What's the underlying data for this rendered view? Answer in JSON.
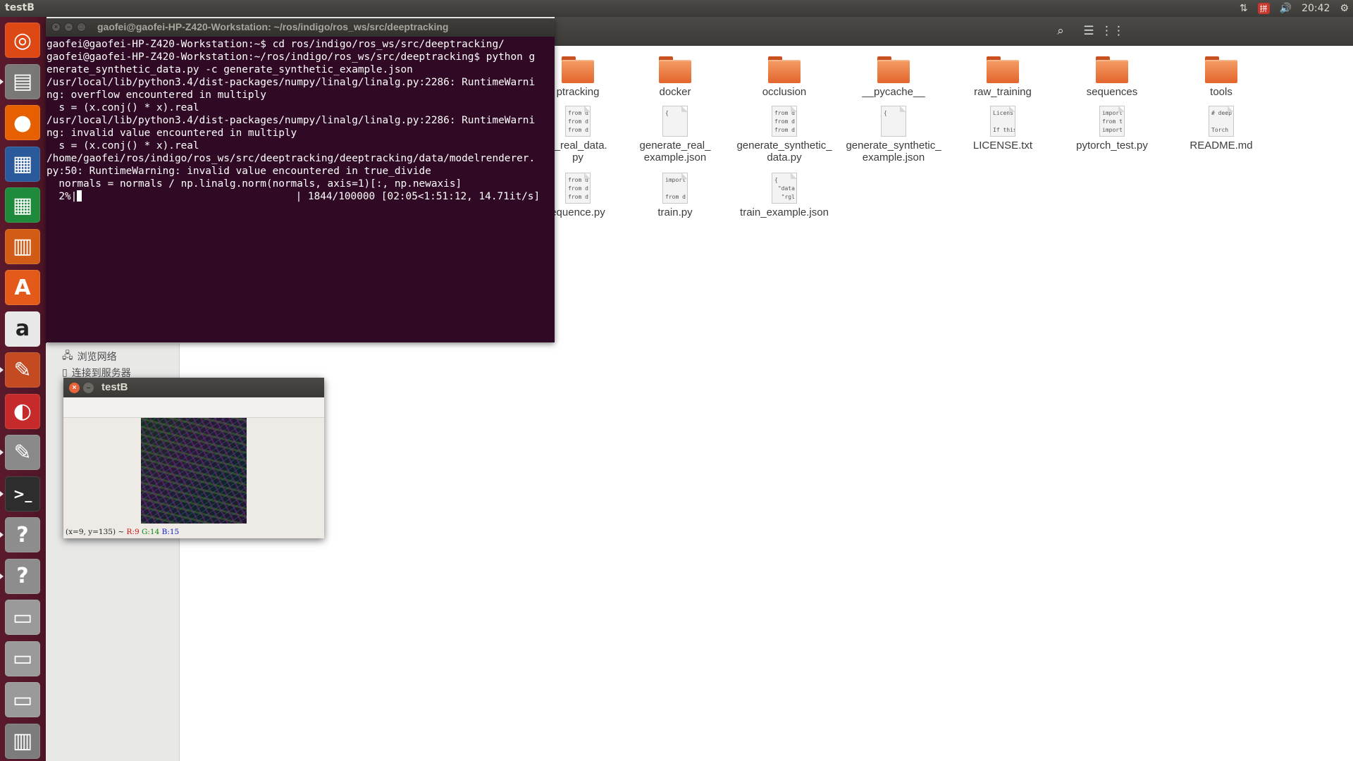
{
  "top_panel": {
    "app_title": "testB",
    "clock": "20:42",
    "tray_icons": [
      "network-arrows-icon",
      "input-method-icon",
      "volume-icon",
      "settings-gear-icon"
    ]
  },
  "launcher": {
    "items": [
      {
        "name": "dash-home",
        "icon": "ubuntu-logo-icon",
        "color": "#dd4814"
      },
      {
        "name": "files",
        "icon": "files-cabinet-icon",
        "color": "#7a7875",
        "running": true
      },
      {
        "name": "firefox",
        "icon": "firefox-icon",
        "color": "#e66000"
      },
      {
        "name": "libreoffice-writer",
        "icon": "writer-icon",
        "color": "#2a5a9c"
      },
      {
        "name": "libreoffice-calc",
        "icon": "calc-icon",
        "color": "#1e8a3c"
      },
      {
        "name": "libreoffice-impress",
        "icon": "impress-icon",
        "color": "#d25c16"
      },
      {
        "name": "software-center",
        "icon": "software-center-bag-icon",
        "color": "#e35a1a"
      },
      {
        "name": "amazon",
        "icon": "amazon-icon",
        "color": "#e8e8e8"
      },
      {
        "name": "system-settings",
        "icon": "settings-tools-icon",
        "color": "#c44a22",
        "running": true
      },
      {
        "name": "pdf-viewer",
        "icon": "pdf-viewer-icon",
        "color": "#c72a2a"
      },
      {
        "name": "text-editor",
        "icon": "text-editor-icon",
        "color": "#8a8a8a",
        "running": true
      },
      {
        "name": "terminal",
        "icon": "terminal-icon",
        "color": "#2d2d2d",
        "running": true
      },
      {
        "name": "unknown-app-1",
        "icon": "question-mark-icon",
        "color": "#8d8d8d",
        "running": true
      },
      {
        "name": "unknown-app-2",
        "icon": "question-mark-icon",
        "color": "#8d8d8d",
        "running": true
      },
      {
        "name": "drive-1",
        "icon": "disk-drive-icon",
        "color": "#9a9a9a"
      },
      {
        "name": "drive-2",
        "icon": "disk-drive-icon",
        "color": "#9a9a9a"
      },
      {
        "name": "drive-3",
        "icon": "disk-drive-icon",
        "color": "#9a9a9a"
      },
      {
        "name": "trash",
        "icon": "trash-icon",
        "color": "#7c7c7c"
      }
    ]
  },
  "file_manager": {
    "header_buttons": [
      "search-icon",
      "list-view-icon",
      "grid-view-icon"
    ],
    "sidebar": {
      "items": [
        {
          "label": "浏览网络",
          "icon": "network-icon"
        },
        {
          "label": "连接到服务器",
          "icon": "server-icon"
        }
      ]
    },
    "files": [
      {
        "name": "ptracking",
        "type": "folder"
      },
      {
        "name": "docker",
        "type": "folder"
      },
      {
        "name": "occlusion",
        "type": "folder"
      },
      {
        "name": "__pycache__",
        "type": "folder"
      },
      {
        "name": "raw_training",
        "type": "folder"
      },
      {
        "name": "sequences",
        "type": "folder"
      },
      {
        "name": "tools",
        "type": "folder"
      },
      {
        "name": "e_real_data.\npy",
        "type": "file",
        "preview": "from d\nfrom d\nfrom d"
      },
      {
        "name": "generate_real_\nexample.json",
        "type": "file",
        "preview": "{"
      },
      {
        "name": "generate_synthetic_\ndata.py",
        "type": "file",
        "preview": "from d\nfrom d\nfrom d"
      },
      {
        "name": "generate_synthetic_\nexample.json",
        "type": "file",
        "preview": "{"
      },
      {
        "name": "LICENSE.txt",
        "type": "file",
        "preview": "Licens\n\nIf this"
      },
      {
        "name": "pytorch_test.py",
        "type": "file",
        "preview": "import\nfrom t\nimport"
      },
      {
        "name": "README.md",
        "type": "file",
        "preview": "# deep\n\nTorch"
      },
      {
        "name": "equence.py",
        "type": "file",
        "preview": "from d\nfrom d\nfrom d"
      },
      {
        "name": "train.py",
        "type": "file",
        "preview": "import\n\nfrom d"
      },
      {
        "name": "train_example.json",
        "type": "file",
        "preview": "{\n \"data\n  \"rgl"
      }
    ]
  },
  "terminal": {
    "title": "gaofei@gaofei-HP-Z420-Workstation: ~/ros/indigo/ros_ws/src/deeptracking",
    "lines": [
      "gaofei@gaofei-HP-Z420-Workstation:~$ cd ros/indigo/ros_ws/src/deeptracking/",
      "gaofei@gaofei-HP-Z420-Workstation:~/ros/indigo/ros_ws/src/deeptracking$ python g",
      "enerate_synthetic_data.py -c generate_synthetic_example.json",
      "/usr/local/lib/python3.4/dist-packages/numpy/linalg/linalg.py:2286: RuntimeWarni",
      "ng: overflow encountered in multiply",
      "  s = (x.conj() * x).real",
      "/usr/local/lib/python3.4/dist-packages/numpy/linalg/linalg.py:2286: RuntimeWarni",
      "ng: invalid value encountered in multiply",
      "  s = (x.conj() * x).real",
      "/home/gaofei/ros/indigo/ros_ws/src/deeptracking/deeptracking/data/modelrenderer.",
      "py:50: RuntimeWarning: invalid value encountered in true_divide",
      "  normals = normals / np.linalg.norm(normals, axis=1)[:, np.newaxis]"
    ],
    "progress_prefix": "  2%|",
    "progress_suffix": "| 1844/100000 [02:05<1:51:12, 14.71it/s]",
    "progress_fraction": 0.02
  },
  "testb_window": {
    "title": "testB",
    "status_prefix": "(x=9, y=135) ~ ",
    "status_r": "R:9",
    "status_g": "G:14",
    "status_b": "B:15"
  }
}
